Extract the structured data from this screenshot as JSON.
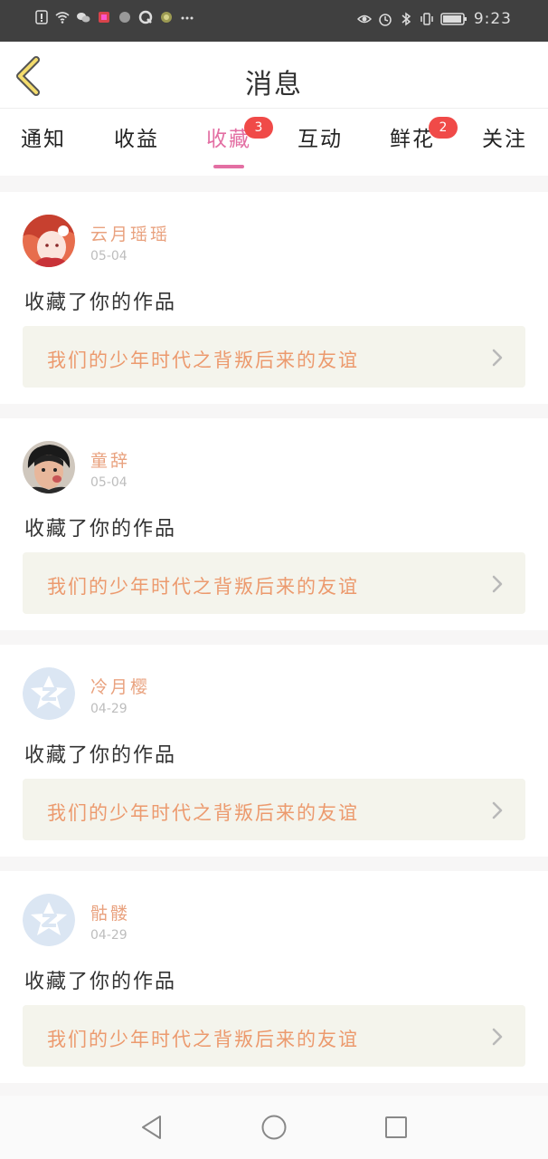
{
  "status_bar": {
    "time": "9:23",
    "left_icons": [
      "alert-icon",
      "wifi-icon",
      "wechat-icon",
      "app-icon",
      "dot-icon",
      "q-icon",
      "app-icon-2",
      "more-icon"
    ],
    "right_icons": [
      "eye-icon",
      "alarm-icon",
      "bluetooth-icon",
      "vibrate-icon",
      "battery-icon"
    ]
  },
  "header": {
    "title": "消息",
    "back_icon": "chevron-left-icon"
  },
  "tabs": [
    {
      "label": "通知"
    },
    {
      "label": "收益"
    },
    {
      "label": "收藏",
      "badge": "3",
      "active": true
    },
    {
      "label": "互动"
    },
    {
      "label": "鲜花",
      "badge": "2"
    },
    {
      "label": "关注"
    }
  ],
  "messages": [
    {
      "username": "云月瑶瑶",
      "date": "05-04",
      "action": "收藏了你的作品",
      "work_title": "我们的少年时代之背叛后来的友谊",
      "avatar": "anime-avatar"
    },
    {
      "username": "童辞",
      "date": "05-04",
      "action": "收藏了你的作品",
      "work_title": "我们的少年时代之背叛后来的友谊",
      "avatar": "photo-avatar"
    },
    {
      "username": "冷月樱",
      "date": "04-29",
      "action": "收藏了你的作品",
      "work_title": "我们的少年时代之背叛后来的友谊",
      "avatar": "default-avatar"
    },
    {
      "username": "骷髅",
      "date": "04-29",
      "action": "收藏了你的作品",
      "work_title": "我们的少年时代之背叛后来的友谊",
      "avatar": "default-avatar"
    }
  ],
  "colors": {
    "accent": "#e36fa3",
    "badge": "#f04a48",
    "username": "#e9a27f",
    "work_title": "#ec9a6e",
    "work_bg": "#f4f4ec"
  },
  "nav_bar": [
    "back-triangle-icon",
    "home-circle-icon",
    "recents-square-icon"
  ]
}
